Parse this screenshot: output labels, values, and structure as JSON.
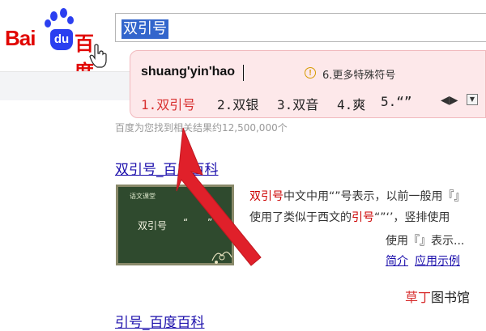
{
  "logo": {
    "bai": "Bai",
    "du": "du",
    "cn": "百度"
  },
  "search": {
    "query": "双引号"
  },
  "ime": {
    "pinyin": "shuang'yin'hao",
    "hint": "6.更多特殊符号",
    "candidates": [
      {
        "label": "1.双引号",
        "selected": true
      },
      {
        "label": "2.双银",
        "selected": false
      },
      {
        "label": "3.双音",
        "selected": false
      },
      {
        "label": "4.爽",
        "selected": false
      },
      {
        "label": "5.“”",
        "selected": false
      }
    ],
    "nav": "◀▶"
  },
  "results": {
    "count": "百度为您找到相关结果约12,500,000个",
    "result1": {
      "title": "双引号_百度百科",
      "thumb_header": "语文课堂",
      "thumb_title": "双引号",
      "thumb_quotes": "“ ”",
      "snippet_line1_hl": "双引号",
      "snippet_line1_rest": "中文中用“”号表示，以前一般用『』",
      "snippet_line2_a": "使用了类似于西文的",
      "snippet_line2_hl": "引号",
      "snippet_line2_b": "“”‘’，竖排使用",
      "snippet_line3": "使用『』表示...",
      "link1": "简介",
      "link2": "应用示例"
    },
    "result2": {
      "title": "引号_百度百科"
    }
  },
  "watermark": {
    "red": "草丁",
    "black": "图书馆"
  },
  "colors": {
    "accent_red": "#e10602",
    "link_blue": "#1a0dab",
    "ime_bg": "#fde8ea",
    "arrow": "#e0202a"
  }
}
